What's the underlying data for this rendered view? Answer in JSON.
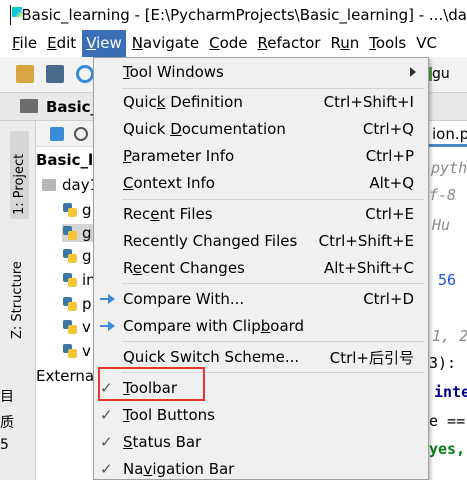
{
  "window": {
    "title": "Basic_learning - [E:\\PycharmProjects\\Basic_learning] - ...\\da"
  },
  "menubar": {
    "items": [
      {
        "label": "File",
        "mnemonic": "F",
        "rest": "ile"
      },
      {
        "label": "Edit",
        "mnemonic": "E",
        "rest": "dit"
      },
      {
        "label": "View",
        "mnemonic": "V",
        "rest": "iew"
      },
      {
        "label": "Navigate",
        "mnemonic": "N",
        "rest": "avigate"
      },
      {
        "label": "Code",
        "mnemonic": "C",
        "rest": "ode"
      },
      {
        "label": "Refactor",
        "mnemonic": "R",
        "rest": "efactor"
      },
      {
        "label": "Run",
        "prefix": "R",
        "mnemonic": "u",
        "rest": "n"
      },
      {
        "label": "Tools",
        "mnemonic": "T",
        "rest": "ools"
      },
      {
        "label": "VC",
        "mnemonic": "",
        "rest": "VC"
      }
    ]
  },
  "toolbar": {
    "run_config_label": "gu"
  },
  "navbar": {
    "project_label": "Basic_"
  },
  "left_strip": {
    "project_tab": "1: Project",
    "structure_tab": "Z: Structure"
  },
  "project_tree": {
    "root": "Basic_le",
    "folder": "day1",
    "files": [
      "g",
      "g",
      "g",
      "in",
      "p",
      "v",
      "v"
    ],
    "external": "External"
  },
  "editor": {
    "tab_label": "ion.py",
    "lines": [
      {
        "text": "pytho",
        "style": "comment"
      },
      {
        "text": "f-8",
        "style": "comment"
      },
      {
        "text": "Hu",
        "style": "comment"
      },
      {
        "text": "56",
        "style": "num"
      },
      {
        "text": "1, 2,",
        "style": "comment"
      },
      {
        "text": "3):",
        "style": "plain"
      },
      {
        "text": "inte",
        "style": "kw"
      },
      {
        "text": "e ==",
        "style": "plain"
      },
      {
        "text": "yes,",
        "style": "str"
      }
    ]
  },
  "edge_fragments": [
    "目",
    "质",
    "5"
  ],
  "view_menu": {
    "items": [
      {
        "pre": "",
        "mn": "T",
        "post": "ool Windows",
        "shortcut": "",
        "submenu": true
      },
      {
        "pre": "Quic",
        "mn": "k",
        "post": " Definition",
        "shortcut": "Ctrl+Shift+I"
      },
      {
        "pre": "Quick ",
        "mn": "D",
        "post": "ocumentation",
        "shortcut": "Ctrl+Q"
      },
      {
        "pre": "",
        "mn": "P",
        "post": "arameter Info",
        "shortcut": "Ctrl+P"
      },
      {
        "pre": "",
        "mn": "C",
        "post": "ontext Info",
        "shortcut": "Alt+Q"
      },
      {
        "pre": "Rec",
        "mn": "e",
        "post": "nt Files",
        "shortcut": "Ctrl+E"
      },
      {
        "pre": "Recently Changed Files",
        "mn": "",
        "post": "",
        "shortcut": "Ctrl+Shift+E"
      },
      {
        "pre": "R",
        "mn": "e",
        "post": "cent Changes",
        "shortcut": "Alt+Shift+C"
      },
      {
        "pre": "Compare With...",
        "mn": "",
        "post": "",
        "shortcut": "Ctrl+D",
        "icon": "compare-arrow-icon"
      },
      {
        "pre": "Compare with Clip",
        "mn": "b",
        "post": "oard",
        "shortcut": "",
        "icon": "compare-arrow-icon"
      },
      {
        "pre": "Quick Switch Scheme...",
        "mn": "",
        "post": "",
        "shortcut": "Ctrl+后引号"
      },
      {
        "pre": "",
        "mn": "T",
        "post": "oolbar",
        "shortcut": "",
        "checked": true
      },
      {
        "pre": "",
        "mn": "T",
        "post": "ool Buttons",
        "shortcut": "",
        "checked": true
      },
      {
        "pre": "",
        "mn": "S",
        "post": "tatus Bar",
        "shortcut": "",
        "checked": true
      },
      {
        "pre": "Na",
        "mn": "v",
        "post": "igation Bar",
        "shortcut": "",
        "checked": true
      }
    ]
  },
  "colors": {
    "menu_active": "#3b6fb5",
    "highlight_box": "#e8332f"
  }
}
